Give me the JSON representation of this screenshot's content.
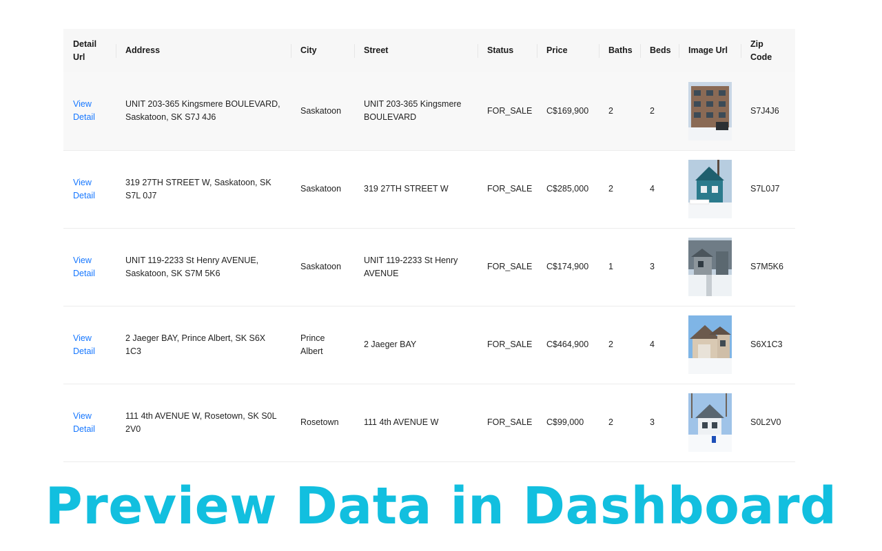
{
  "table": {
    "columns": [
      "Detail Url",
      "Address",
      "City",
      "Street",
      "Status",
      "Price",
      "Baths",
      "Beds",
      "Image Url",
      "Zip Code"
    ],
    "rows": [
      {
        "detail": "View Detail",
        "address": "UNIT 203-365 Kingsmere BOULEVARD, Saskatoon, SK S7J 4J6",
        "city": "Saskatoon",
        "street": "UNIT 203-365 Kingsmere BOULEVARD",
        "status": "FOR_SALE",
        "price": "C$169,900",
        "baths": "2",
        "beds": "2",
        "image": "apartment-building-photo",
        "zip": "S7J4J6"
      },
      {
        "detail": "View Detail",
        "address": "319 27TH STREET W, Saskatoon, SK S7L 0J7",
        "city": "Saskatoon",
        "street": "319 27TH STREET W",
        "status": "FOR_SALE",
        "price": "C$285,000",
        "baths": "2",
        "beds": "4",
        "image": "blue-house-photo",
        "zip": "S7L0J7"
      },
      {
        "detail": "View Detail",
        "address": "UNIT 119-2233 St Henry AVENUE, Saskatoon, SK S7M 5K6",
        "city": "Saskatoon",
        "street": "UNIT 119-2233 St Henry AVENUE",
        "status": "FOR_SALE",
        "price": "C$174,900",
        "baths": "1",
        "beds": "3",
        "image": "townhouse-photo",
        "zip": "S7M5K6"
      },
      {
        "detail": "View Detail",
        "address": "2 Jaeger BAY, Prince Albert, SK S6X 1C3",
        "city": "Prince Albert",
        "street": "2 Jaeger BAY",
        "status": "FOR_SALE",
        "price": "C$464,900",
        "baths": "2",
        "beds": "4",
        "image": "beige-house-photo",
        "zip": "S6X1C3"
      },
      {
        "detail": "View Detail",
        "address": "111 4th AVENUE W, Rosetown, SK S0L 2V0",
        "city": "Rosetown",
        "street": "111 4th AVENUE W",
        "status": "FOR_SALE",
        "price": "C$99,000",
        "baths": "2",
        "beds": "3",
        "image": "white-house-photo",
        "zip": "S0L2V0"
      }
    ]
  },
  "banner": {
    "text": "Preview Data in Dashboard"
  },
  "colors": {
    "link": "#1677ff",
    "banner": "#12bfdf",
    "header_bg": "#f7f7f7"
  }
}
